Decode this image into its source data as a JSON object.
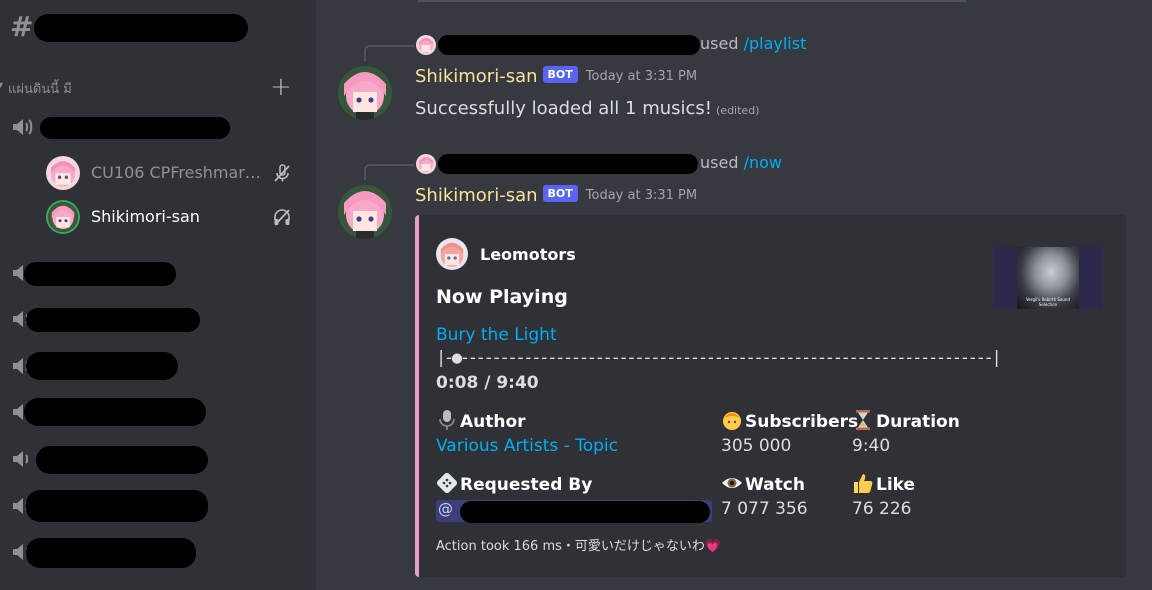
{
  "sidebar": {
    "channel_icon": "hash-icon",
    "category_label": "แผ่นดินนี้ มี",
    "add_icon": "plus-icon",
    "voice_users": [
      {
        "name": "CU106 CPFreshmar…",
        "status_icon": "mic-muted-icon"
      },
      {
        "name": "Shikimori-san",
        "status_icon": "deafened-icon"
      }
    ]
  },
  "messages": [
    {
      "reply_used": "used",
      "command": "/playlist",
      "username": "Shikimori-san",
      "bot_tag": "BOT",
      "timestamp": "Today at 3:31 PM",
      "text": "Successfully loaded all 1 musics!",
      "edited": "(edited)"
    },
    {
      "reply_used": "used",
      "command": "/now",
      "username": "Shikimori-san",
      "bot_tag": "BOT",
      "timestamp": "Today at 3:31 PM"
    }
  ],
  "embed": {
    "accent_color": "#eba0c9",
    "author": "Leomotors",
    "title": "Now Playing",
    "track_link": "Bury the Light",
    "progress_bar": "|-●-------------------------------------------------------------------|",
    "progress_fraction": 0.014,
    "time": "0:08 / 9:40",
    "thumbnail_caption": "Vergil's Rebirth Sound Selection",
    "fields": {
      "author": {
        "name": "Author",
        "value": "Various Artists - Topic",
        "emoji": "microphone-emoji"
      },
      "subscribers": {
        "name": "Subscribers",
        "value": "305 000",
        "emoji": "person-emoji"
      },
      "duration": {
        "name": "Duration",
        "value": "9:40",
        "emoji": "hourglass-emoji"
      },
      "requested_by": {
        "name": "Requested By",
        "mention_prefix": "@",
        "emoji": "game-die-emoji"
      },
      "watch": {
        "name": "Watch",
        "value": "7 077 356",
        "emoji": "eye-emoji"
      },
      "like": {
        "name": "Like",
        "value": "76 226",
        "emoji": "thumbs-up-emoji"
      }
    },
    "footer": "Action took 166 ms・可愛いだけじゃないわ💗"
  }
}
